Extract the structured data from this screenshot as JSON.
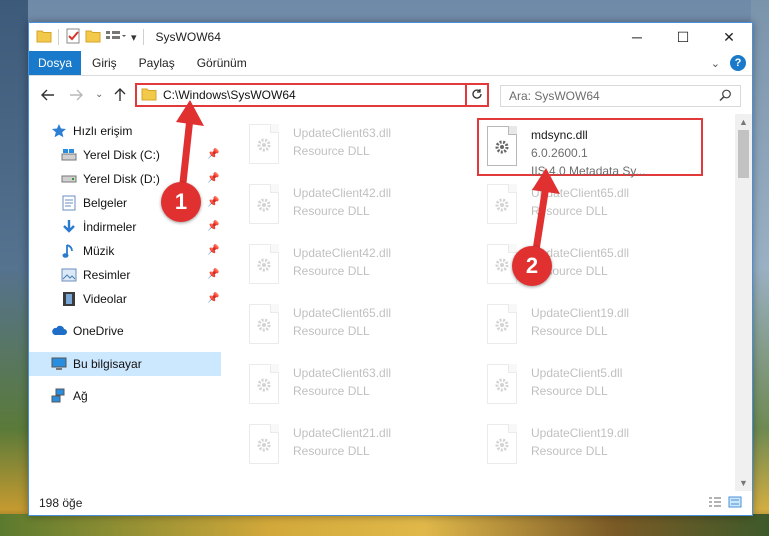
{
  "window": {
    "title": "SysWOW64",
    "minimize": "─",
    "maximize": "☐",
    "close": "✕"
  },
  "ribbon": {
    "file_tab": "Dosya",
    "tabs": [
      "Giriş",
      "Paylaş",
      "Görünüm"
    ]
  },
  "address": {
    "path": "C:\\Windows\\SysWOW64",
    "search_placeholder": "Ara: SysWOW64"
  },
  "sidebar": {
    "quick_access": "Hızlı erişim",
    "items": [
      "Yerel Disk (C:)",
      "Yerel Disk (D:)",
      "Belgeler",
      "İndirmeler",
      "Müzik",
      "Resimler",
      "Videolar"
    ],
    "onedrive": "OneDrive",
    "this_pc": "Bu bilgisayar",
    "network": "Ağ"
  },
  "files": {
    "highlighted": {
      "name": "mdsync.dll",
      "version": "6.0.2600.1",
      "description": "IIS 4.0 Metadata Sy..."
    },
    "left_column": [
      {
        "name": "UpdateClient63.dll",
        "desc": "Resource DLL"
      },
      {
        "name": "UpdateClient42.dll",
        "desc": "Resource DLL"
      },
      {
        "name": "UpdateClient42.dll",
        "desc": "Resource DLL"
      },
      {
        "name": "UpdateClient65.dll",
        "desc": "Resource DLL"
      },
      {
        "name": "UpdateClient63.dll",
        "desc": "Resource DLL"
      },
      {
        "name": "UpdateClient21.dll",
        "desc": "Resource DLL"
      }
    ],
    "right_column": [
      {
        "name": "UpdateClient65.dll",
        "desc": "Resource DLL"
      },
      {
        "name": "UpdateClient65.dll",
        "desc": "Resource DLL"
      },
      {
        "name": "UpdateClient19.dll",
        "desc": "Resource DLL"
      },
      {
        "name": "UpdateClient5.dll",
        "desc": "Resource DLL"
      },
      {
        "name": "UpdateClient19.dll",
        "desc": "Resource DLL"
      }
    ]
  },
  "status": {
    "item_count": "198 öğe"
  },
  "callouts": [
    "1",
    "2"
  ],
  "colors": {
    "accent": "#1979ca",
    "highlight_red": "#e23a3a",
    "selection": "#cce8ff"
  }
}
